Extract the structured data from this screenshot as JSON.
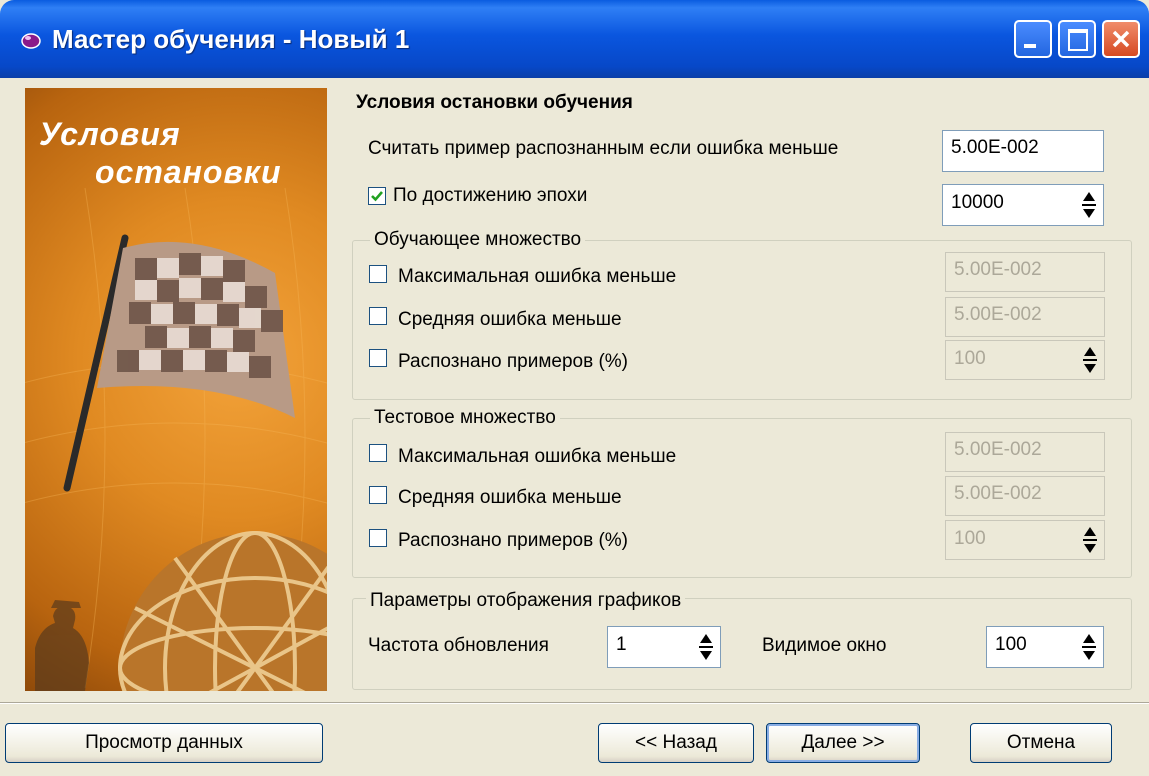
{
  "window": {
    "title": "Мастер обучения - Новый 1"
  },
  "picture": {
    "line1": "Условия",
    "line2": "остановки"
  },
  "main": {
    "heading": "Условия остановки обучения",
    "recognize_label": "Считать пример распознанным если ошибка меньше",
    "recognize_value": "5.00E-002",
    "epoch_label": "По достижению эпохи",
    "epoch_checked": true,
    "epoch_value": "10000"
  },
  "training_set": {
    "title": "Обучающее множество",
    "max_error_label": "Максимальная ошибка меньше",
    "max_error_value": "5.00E-002",
    "avg_error_label": "Средняя ошибка меньше",
    "avg_error_value": "5.00E-002",
    "recognized_label": "Распознано примеров (%)",
    "recognized_value": "100"
  },
  "test_set": {
    "title": "Тестовое множество",
    "max_error_label": "Максимальная ошибка меньше",
    "max_error_value": "5.00E-002",
    "avg_error_label": "Средняя ошибка меньше",
    "avg_error_value": "5.00E-002",
    "recognized_label": "Распознано примеров (%)",
    "recognized_value": "100"
  },
  "graph_params": {
    "title": "Параметры отображения графиков",
    "frequency_label": "Частота обновления",
    "frequency_value": "1",
    "window_label": "Видимое окно",
    "window_value": "100"
  },
  "buttons": {
    "view_data": "Просмотр данных",
    "back": "<< Назад",
    "next": "Далее >>",
    "cancel": "Отмена"
  },
  "colors": {
    "titlebar": "#0a56df",
    "face": "#ece9d8",
    "picture": "#e08a22"
  }
}
